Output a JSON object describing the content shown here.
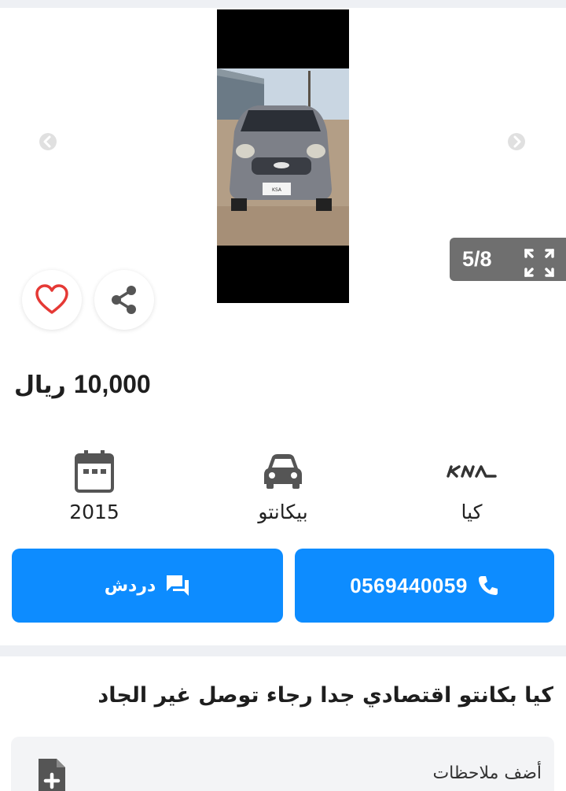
{
  "gallery": {
    "counter": "5/8",
    "current": 5,
    "total": 8,
    "plate": "KSA"
  },
  "listing": {
    "price_amount": "10,000",
    "price_currency": "ريال",
    "title": "كيا بكانتو اقتصادي جدا رجاء توصل غير الجاد"
  },
  "specs": {
    "year": "2015",
    "model": "بيكانتو",
    "make": "كيا",
    "make_logo": "KIA"
  },
  "actions": {
    "phone": "0569440059",
    "chat": "دردش"
  },
  "notes": {
    "label": "أضف ملاحظات"
  },
  "colors": {
    "accent": "#0d8cff",
    "heart": "#e53935",
    "counter_bg": "#6f6f6f"
  },
  "icons": {
    "prev": "chevron-left-icon",
    "next": "chevron-right-icon",
    "expand": "expand-icon",
    "favorite": "heart-icon",
    "share": "share-icon",
    "year": "calendar-icon",
    "model": "car-icon",
    "phone": "phone-icon",
    "chat": "chat-icon",
    "note": "note-add-icon"
  }
}
